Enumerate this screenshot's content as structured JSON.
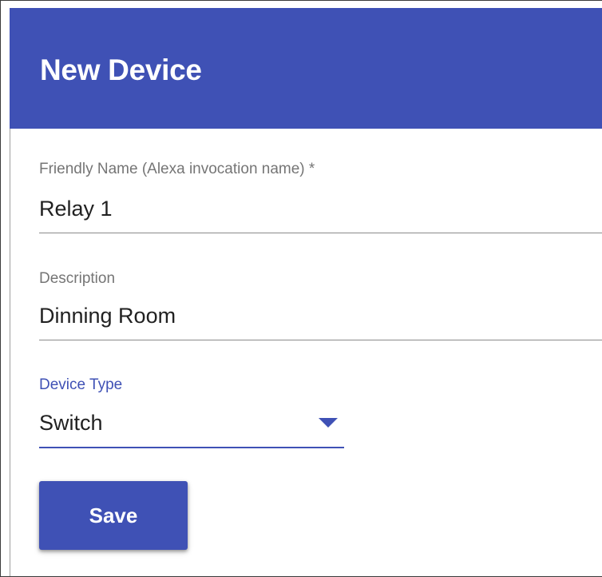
{
  "header": {
    "title": "New Device",
    "background_color": "#3f51b5"
  },
  "form": {
    "friendly_name": {
      "label": "Friendly Name (Alexa invocation name) *",
      "value": "Relay 1"
    },
    "description": {
      "label": "Description",
      "value": "Dinning Room"
    },
    "device_type": {
      "label": "Device Type",
      "value": "Switch",
      "icon": "triangle-down-icon",
      "accent_color": "#3f51b5"
    },
    "save_button": {
      "label": "Save"
    }
  }
}
